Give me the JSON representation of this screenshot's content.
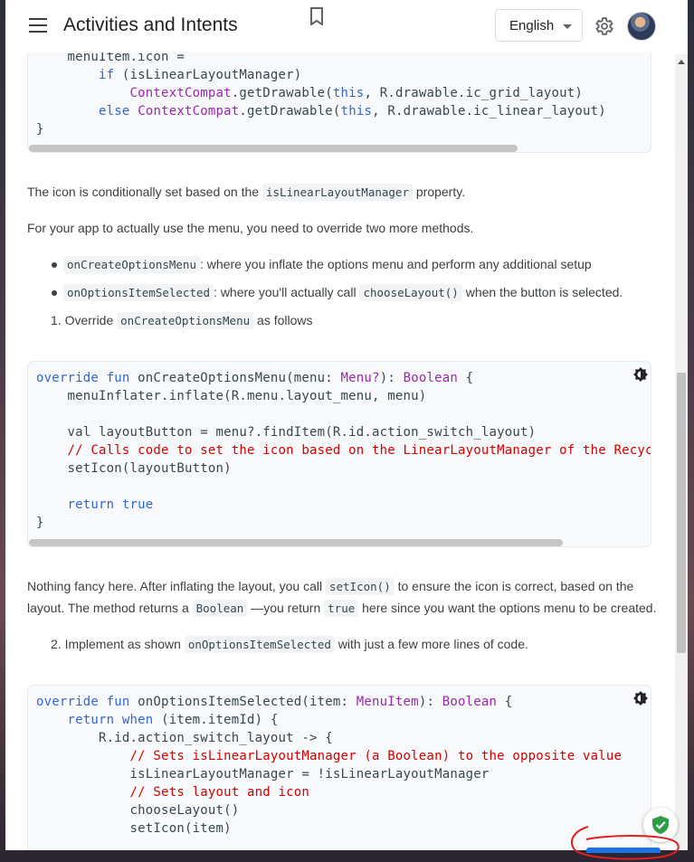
{
  "header": {
    "title": "Activities and Intents",
    "language": "English"
  },
  "code1": {
    "line0": "    menuItem.icon =",
    "line1_kw": "if",
    "line1_rest": " (isLinearLayoutManager)",
    "line2_ty": "ContextCompat",
    "line2_rest": ".getDrawable(",
    "line2_this": "this",
    "line2_end": ", R.drawable.ic_grid_layout)",
    "line3_kw": "else",
    "line3_ty": "ContextCompat",
    "line3_rest": ".getDrawable(",
    "line3_this": "this",
    "line3_end": ", R.drawable.ic_linear_layout)",
    "line4": "}"
  },
  "text": {
    "p1_before": "The icon is conditionally set based on the ",
    "p1_code": "isLinearLayoutManager",
    "p1_after": " property.",
    "p2": "For your app to actually use the menu, you need to override two more methods.",
    "b1_code": "onCreateOptionsMenu",
    "b1_text": ": where you inflate the options menu and perform any additional setup",
    "b2_code": "onOptionsItemSelected",
    "b2_text": ": where you'll actually call ",
    "b2_code2": "chooseLayout()",
    "b2_after": " when the button is selected.",
    "step1_num": "1. Override ",
    "step1_code": "onCreateOptionsMenu",
    "step1_after": " as follows",
    "p3_l1_before": "Nothing fancy here. After inflating the layout, you call ",
    "p3_l1_code": "setIcon()",
    "p3_l1_after": " to ensure the icon is correct, based on the",
    "p3_l2_before": "layout. The method returns a ",
    "p3_l2_code": "Boolean",
    "p3_l2_mid": " —you return ",
    "p3_l2_code2": "true",
    "p3_l2_after": " here since you want the options menu to be created.",
    "step2_num": "2. Implement as shown ",
    "step2_code": "onOptionsItemSelected",
    "step2_after": " with just a few more lines of code."
  },
  "code2": {
    "l1_kw1": "override fun",
    "l1_fn": " onCreateOptionsMenu(menu: ",
    "l1_ty1": "Menu?",
    "l1_mid": "): ",
    "l1_ty2": "Boolean",
    "l1_end": " {",
    "l2": "    menuInflater.inflate(R.menu.layout_menu, menu)",
    "l4": "    val layoutButton = menu?.findItem(R.id.action_switch_layout)",
    "l5_cm": "    // Calls code to set the icon based on the LinearLayoutManager of the RecyclerView",
    "l6": "    setIcon(layoutButton)",
    "l8_kw": "return true",
    "l9": "}"
  },
  "code3": {
    "l1_kw1": "override fun",
    "l1_fn": " onOptionsItemSelected(item: ",
    "l1_ty1": "MenuItem",
    "l1_mid": "): ",
    "l1_ty2": "Boolean",
    "l1_end": " {",
    "l2_kw": "return when",
    "l2_rest": " (item.itemId) {",
    "l3": "        R.id.action_switch_layout -> {",
    "l4_cm": "            // Sets isLinearLayoutManager (a Boolean) to the opposite value",
    "l5": "            isLinearLayoutManager = !isLinearLayoutManager",
    "l6_cm": "            // Sets layout and icon",
    "l7": "            chooseLayout()",
    "l8": "            setIcon(item)"
  }
}
